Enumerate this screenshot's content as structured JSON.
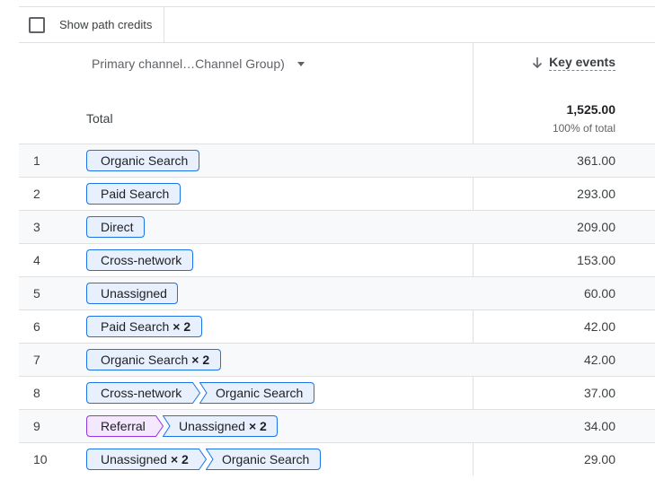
{
  "toolbar": {
    "show_path_credits_label": "Show path credits",
    "show_path_credits_checked": false
  },
  "columns": {
    "dimension_label": "Primary channel…Channel Group)",
    "metric_label": "Key events"
  },
  "total": {
    "label": "Total",
    "value": "1,525.00",
    "percent": "100% of total"
  },
  "colors": {
    "chip_fill": "#e8f0fe",
    "chip_border": "#1a73e8",
    "referral_fill": "#f3e8fd",
    "referral_border": "#9334e6"
  },
  "rows": [
    {
      "num": "1",
      "value": "361.00",
      "path": [
        {
          "label": "Organic Search",
          "mult": ""
        }
      ]
    },
    {
      "num": "2",
      "value": "293.00",
      "path": [
        {
          "label": "Paid Search",
          "mult": ""
        }
      ]
    },
    {
      "num": "3",
      "value": "209.00",
      "path": [
        {
          "label": "Direct",
          "mult": ""
        }
      ]
    },
    {
      "num": "4",
      "value": "153.00",
      "path": [
        {
          "label": "Cross-network",
          "mult": ""
        }
      ]
    },
    {
      "num": "5",
      "value": "60.00",
      "path": [
        {
          "label": "Unassigned",
          "mult": ""
        }
      ]
    },
    {
      "num": "6",
      "value": "42.00",
      "path": [
        {
          "label": "Paid Search",
          "mult": "× 2"
        }
      ]
    },
    {
      "num": "7",
      "value": "42.00",
      "path": [
        {
          "label": "Organic Search",
          "mult": "× 2"
        }
      ]
    },
    {
      "num": "8",
      "value": "37.00",
      "path": [
        {
          "label": "Cross-network",
          "mult": ""
        },
        {
          "label": "Organic Search",
          "mult": ""
        }
      ]
    },
    {
      "num": "9",
      "value": "34.00",
      "path": [
        {
          "label": "Referral",
          "mult": "",
          "type": "referral"
        },
        {
          "label": "Unassigned",
          "mult": "× 2"
        }
      ]
    },
    {
      "num": "10",
      "value": "29.00",
      "path": [
        {
          "label": "Unassigned",
          "mult": "× 2"
        },
        {
          "label": "Organic Search",
          "mult": ""
        }
      ]
    }
  ]
}
